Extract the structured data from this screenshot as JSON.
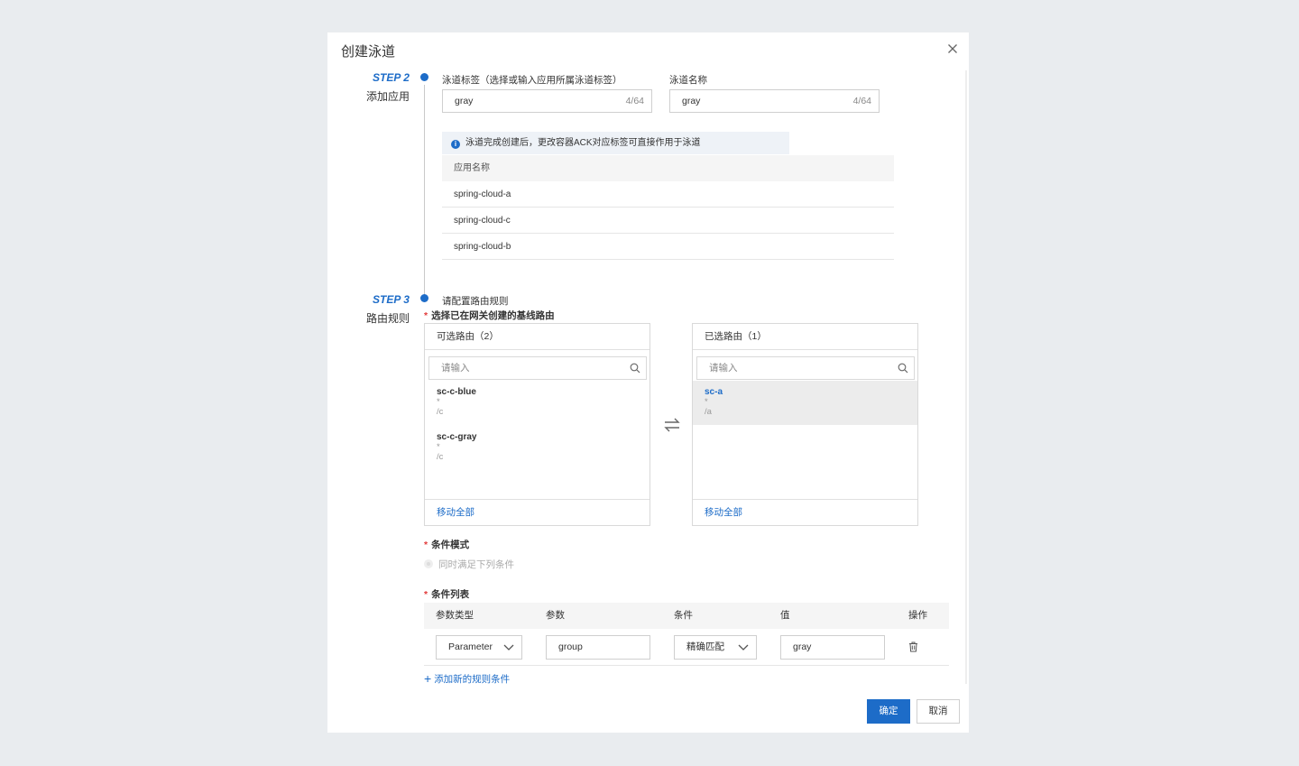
{
  "dialog": {
    "title": "创建泳道"
  },
  "step2": {
    "step": "STEP 2",
    "title": "添加应用",
    "tag_label": "泳道标签（选择或输入应用所属泳道标签）",
    "tag_value": "gray",
    "tag_count": "4/64",
    "name_label": "泳道名称",
    "name_value": "gray",
    "name_count": "4/64",
    "notice": "泳道完成创建后，更改容器ACK对应标签可直接作用于泳道",
    "apps": {
      "header": "应用名称",
      "rows": [
        "spring-cloud-a",
        "spring-cloud-c",
        "spring-cloud-b"
      ]
    }
  },
  "step3": {
    "step": "STEP 3",
    "title": "路由规则",
    "subtitle": "请配置路由规则",
    "baseline_label": "选择已在网关创建的基线路由",
    "available": {
      "title": "可选路由（2）",
      "placeholder": "请输入",
      "items": [
        {
          "name": "sc-c-blue",
          "star": "*",
          "path": "/c"
        },
        {
          "name": "sc-c-gray",
          "star": "*",
          "path": "/c"
        }
      ],
      "footer": "移动全部"
    },
    "selected": {
      "title": "已选路由（1）",
      "placeholder": "请输入",
      "items": [
        {
          "name": "sc-a",
          "star": "*",
          "path": "/a"
        }
      ],
      "footer": "移动全部"
    },
    "mode_label": "条件模式",
    "mode_option": "同时满足下列条件",
    "cond_label": "条件列表",
    "cond_headers": {
      "type": "参数类型",
      "param": "参数",
      "cond": "条件",
      "value": "值",
      "ops": "操作"
    },
    "cond_row": {
      "type": "Parameter",
      "param": "group",
      "cond": "精确匹配",
      "value": "gray"
    },
    "add_rule": "添加新的规则条件"
  },
  "footer": {
    "ok": "确定",
    "cancel": "取消"
  },
  "colors": {
    "accent": "#1d6cc8",
    "required": "#e23b3b"
  }
}
